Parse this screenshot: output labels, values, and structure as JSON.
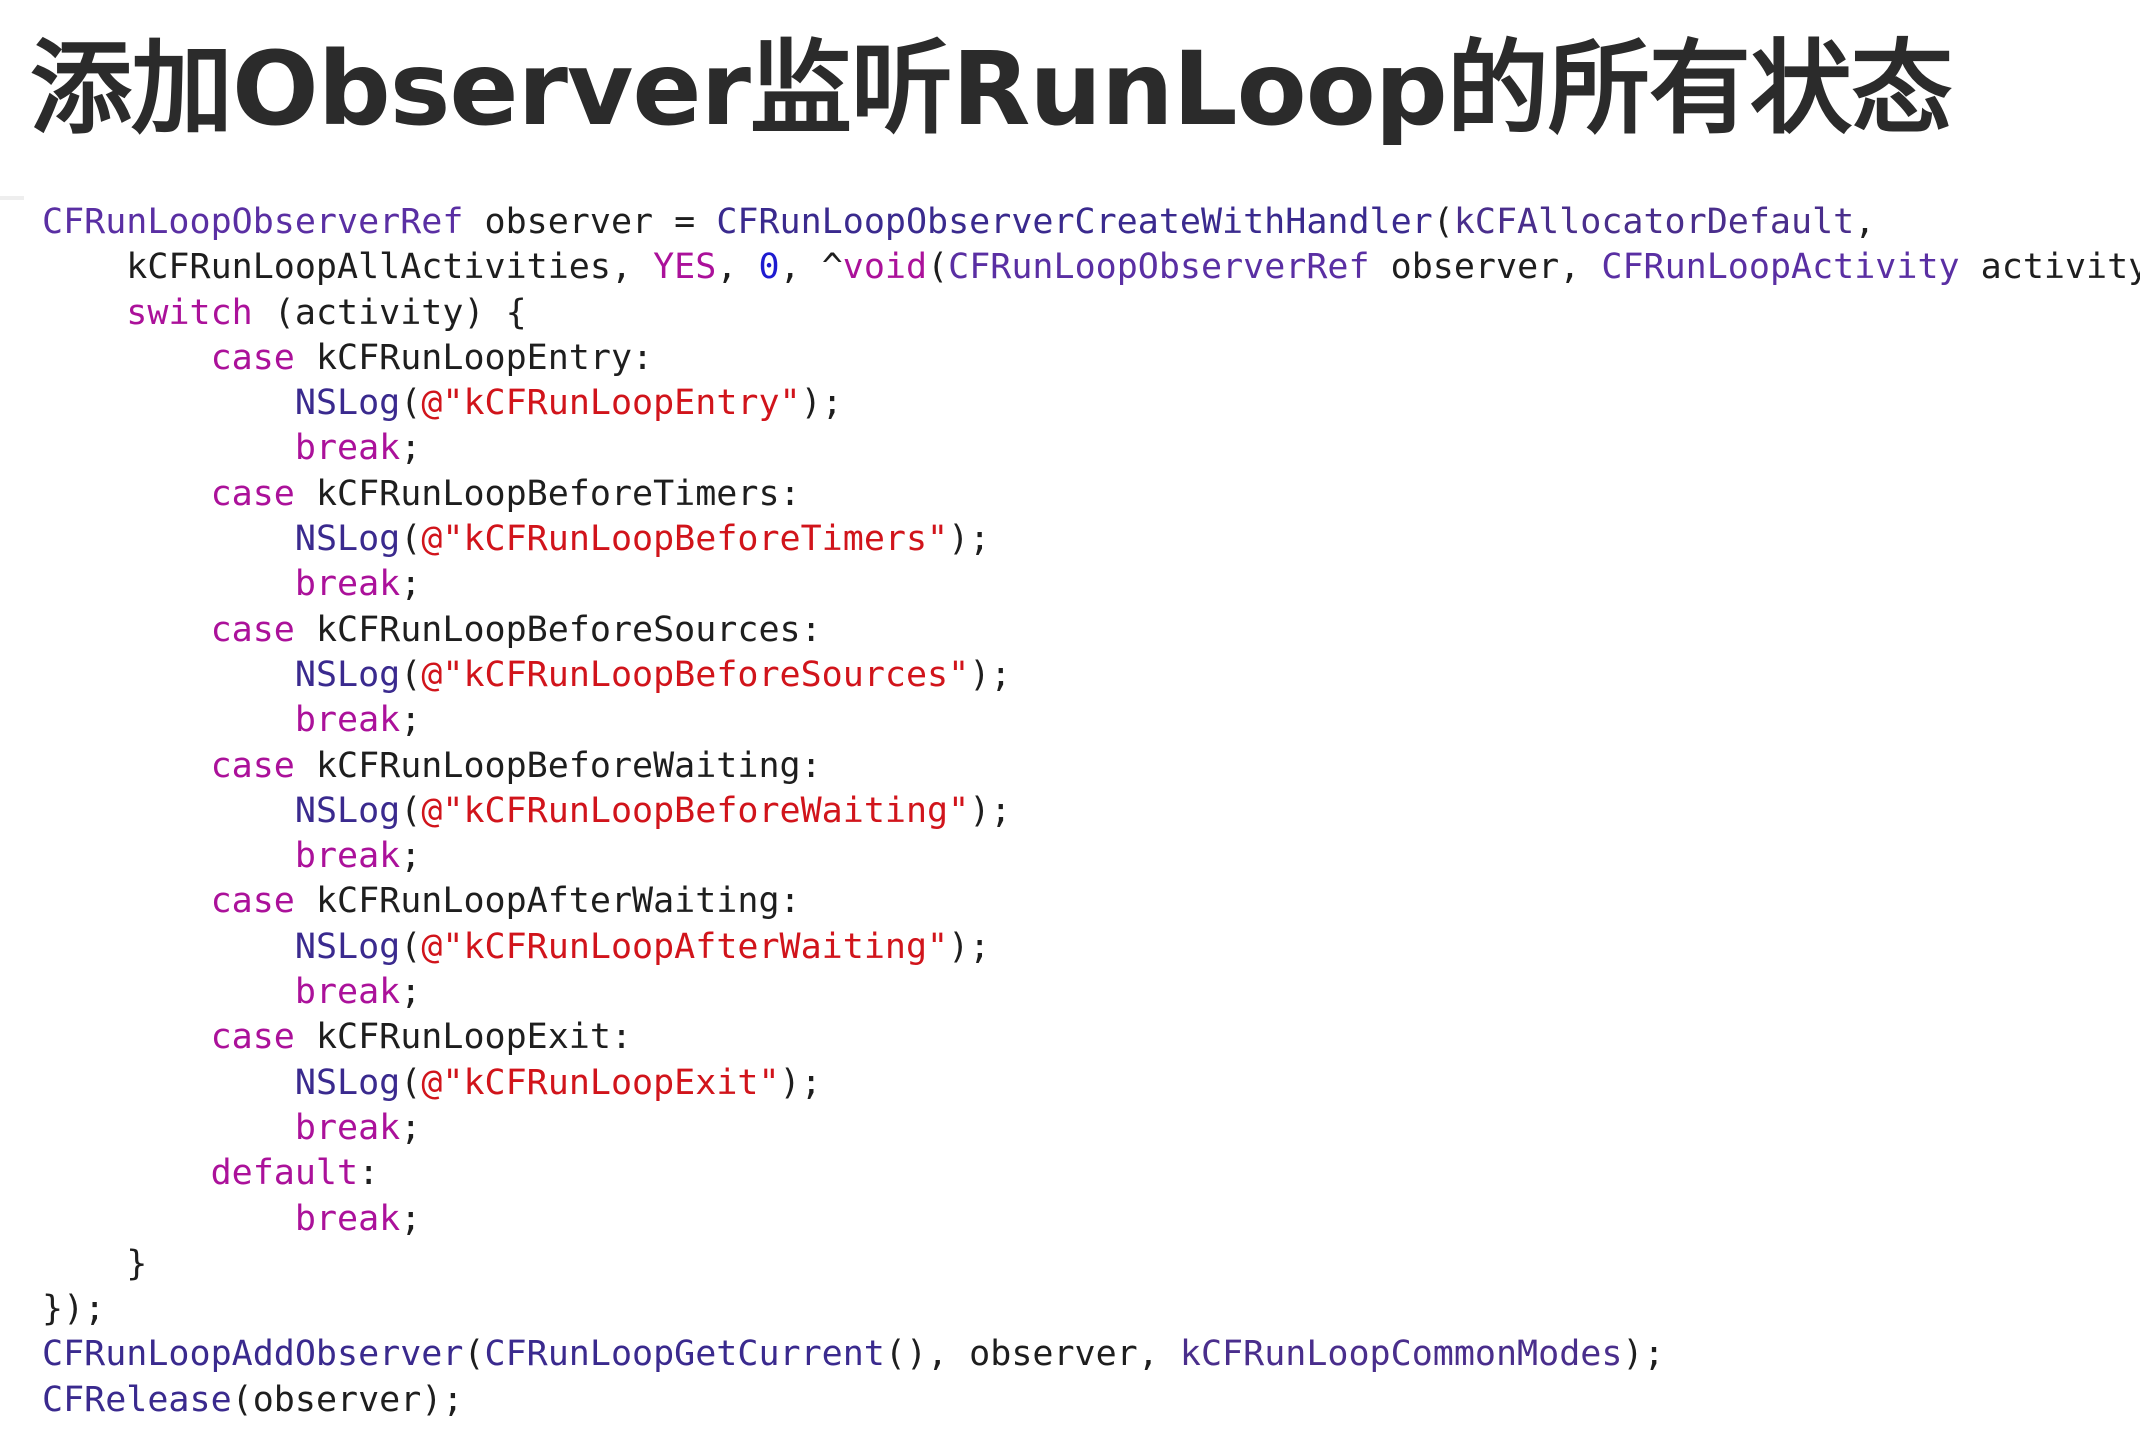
{
  "slide": {
    "title": "添加Observer监听RunLoop的所有状态"
  },
  "code": {
    "lines": [
      [
        {
          "t": "CFRunLoopObserverRef",
          "c": "type"
        },
        {
          "t": " observer = ",
          "c": "plain"
        },
        {
          "t": "CFRunLoopObserverCreateWithHandler",
          "c": "func"
        },
        {
          "t": "(",
          "c": "plain"
        },
        {
          "t": "kCFAllocatorDefault",
          "c": "const"
        },
        {
          "t": ",",
          "c": "plain"
        }
      ],
      [
        {
          "t": "    kCFRunLoopAllActivities, ",
          "c": "plain"
        },
        {
          "t": "YES",
          "c": "keyword"
        },
        {
          "t": ", ",
          "c": "plain"
        },
        {
          "t": "0",
          "c": "number"
        },
        {
          "t": ", ^",
          "c": "plain"
        },
        {
          "t": "void",
          "c": "keyword"
        },
        {
          "t": "(",
          "c": "plain"
        },
        {
          "t": "CFRunLoopObserverRef",
          "c": "type"
        },
        {
          "t": " observer, ",
          "c": "plain"
        },
        {
          "t": "CFRunLoopActivity",
          "c": "type"
        },
        {
          "t": " activity) {",
          "c": "plain"
        }
      ],
      [
        {
          "t": "    ",
          "c": "plain"
        },
        {
          "t": "switch",
          "c": "keyword"
        },
        {
          "t": " (activity) {",
          "c": "plain"
        }
      ],
      [
        {
          "t": "        ",
          "c": "plain"
        },
        {
          "t": "case",
          "c": "keyword"
        },
        {
          "t": " kCFRunLoopEntry:",
          "c": "plain"
        }
      ],
      [
        {
          "t": "            ",
          "c": "plain"
        },
        {
          "t": "NSLog",
          "c": "func"
        },
        {
          "t": "(",
          "c": "plain"
        },
        {
          "t": "@\"kCFRunLoopEntry\"",
          "c": "string"
        },
        {
          "t": ");",
          "c": "plain"
        }
      ],
      [
        {
          "t": "            ",
          "c": "plain"
        },
        {
          "t": "break",
          "c": "keyword"
        },
        {
          "t": ";",
          "c": "plain"
        }
      ],
      [
        {
          "t": "        ",
          "c": "plain"
        },
        {
          "t": "case",
          "c": "keyword"
        },
        {
          "t": " kCFRunLoopBeforeTimers:",
          "c": "plain"
        }
      ],
      [
        {
          "t": "            ",
          "c": "plain"
        },
        {
          "t": "NSLog",
          "c": "func"
        },
        {
          "t": "(",
          "c": "plain"
        },
        {
          "t": "@\"kCFRunLoopBeforeTimers\"",
          "c": "string"
        },
        {
          "t": ");",
          "c": "plain"
        }
      ],
      [
        {
          "t": "            ",
          "c": "plain"
        },
        {
          "t": "break",
          "c": "keyword"
        },
        {
          "t": ";",
          "c": "plain"
        }
      ],
      [
        {
          "t": "        ",
          "c": "plain"
        },
        {
          "t": "case",
          "c": "keyword"
        },
        {
          "t": " kCFRunLoopBeforeSources:",
          "c": "plain"
        }
      ],
      [
        {
          "t": "            ",
          "c": "plain"
        },
        {
          "t": "NSLog",
          "c": "func"
        },
        {
          "t": "(",
          "c": "plain"
        },
        {
          "t": "@\"kCFRunLoopBeforeSources\"",
          "c": "string"
        },
        {
          "t": ");",
          "c": "plain"
        }
      ],
      [
        {
          "t": "            ",
          "c": "plain"
        },
        {
          "t": "break",
          "c": "keyword"
        },
        {
          "t": ";",
          "c": "plain"
        }
      ],
      [
        {
          "t": "        ",
          "c": "plain"
        },
        {
          "t": "case",
          "c": "keyword"
        },
        {
          "t": " kCFRunLoopBeforeWaiting:",
          "c": "plain"
        }
      ],
      [
        {
          "t": "            ",
          "c": "plain"
        },
        {
          "t": "NSLog",
          "c": "func"
        },
        {
          "t": "(",
          "c": "plain"
        },
        {
          "t": "@\"kCFRunLoopBeforeWaiting\"",
          "c": "string"
        },
        {
          "t": ");",
          "c": "plain"
        }
      ],
      [
        {
          "t": "            ",
          "c": "plain"
        },
        {
          "t": "break",
          "c": "keyword"
        },
        {
          "t": ";",
          "c": "plain"
        }
      ],
      [
        {
          "t": "        ",
          "c": "plain"
        },
        {
          "t": "case",
          "c": "keyword"
        },
        {
          "t": " kCFRunLoopAfterWaiting:",
          "c": "plain"
        }
      ],
      [
        {
          "t": "            ",
          "c": "plain"
        },
        {
          "t": "NSLog",
          "c": "func"
        },
        {
          "t": "(",
          "c": "plain"
        },
        {
          "t": "@\"kCFRunLoopAfterWaiting\"",
          "c": "string"
        },
        {
          "t": ");",
          "c": "plain"
        }
      ],
      [
        {
          "t": "            ",
          "c": "plain"
        },
        {
          "t": "break",
          "c": "keyword"
        },
        {
          "t": ";",
          "c": "plain"
        }
      ],
      [
        {
          "t": "        ",
          "c": "plain"
        },
        {
          "t": "case",
          "c": "keyword"
        },
        {
          "t": " kCFRunLoopExit:",
          "c": "plain"
        }
      ],
      [
        {
          "t": "            ",
          "c": "plain"
        },
        {
          "t": "NSLog",
          "c": "func"
        },
        {
          "t": "(",
          "c": "plain"
        },
        {
          "t": "@\"kCFRunLoopExit\"",
          "c": "string"
        },
        {
          "t": ");",
          "c": "plain"
        }
      ],
      [
        {
          "t": "            ",
          "c": "plain"
        },
        {
          "t": "break",
          "c": "keyword"
        },
        {
          "t": ";",
          "c": "plain"
        }
      ],
      [
        {
          "t": "        ",
          "c": "plain"
        },
        {
          "t": "default",
          "c": "keyword"
        },
        {
          "t": ":",
          "c": "plain"
        }
      ],
      [
        {
          "t": "            ",
          "c": "plain"
        },
        {
          "t": "break",
          "c": "keyword"
        },
        {
          "t": ";",
          "c": "plain"
        }
      ],
      [
        {
          "t": "    }",
          "c": "plain"
        }
      ],
      [
        {
          "t": "});",
          "c": "plain"
        }
      ],
      [
        {
          "t": "CFRunLoopAddObserver",
          "c": "func"
        },
        {
          "t": "(",
          "c": "plain"
        },
        {
          "t": "CFRunLoopGetCurrent",
          "c": "func"
        },
        {
          "t": "(), observer, ",
          "c": "plain"
        },
        {
          "t": "kCFRunLoopCommonModes",
          "c": "const"
        },
        {
          "t": ");",
          "c": "plain"
        }
      ],
      [
        {
          "t": "CFRelease",
          "c": "func"
        },
        {
          "t": "(observer);",
          "c": "plain"
        }
      ]
    ]
  },
  "colors": {
    "plain": "#1e1e1e",
    "type": "#5a2fa3",
    "func": "#3a2a8e",
    "keyword": "#ab119a",
    "string": "#d1141b",
    "const": "#4a2e8c",
    "number": "#1e1bd0",
    "title": "#2b2b2b"
  }
}
